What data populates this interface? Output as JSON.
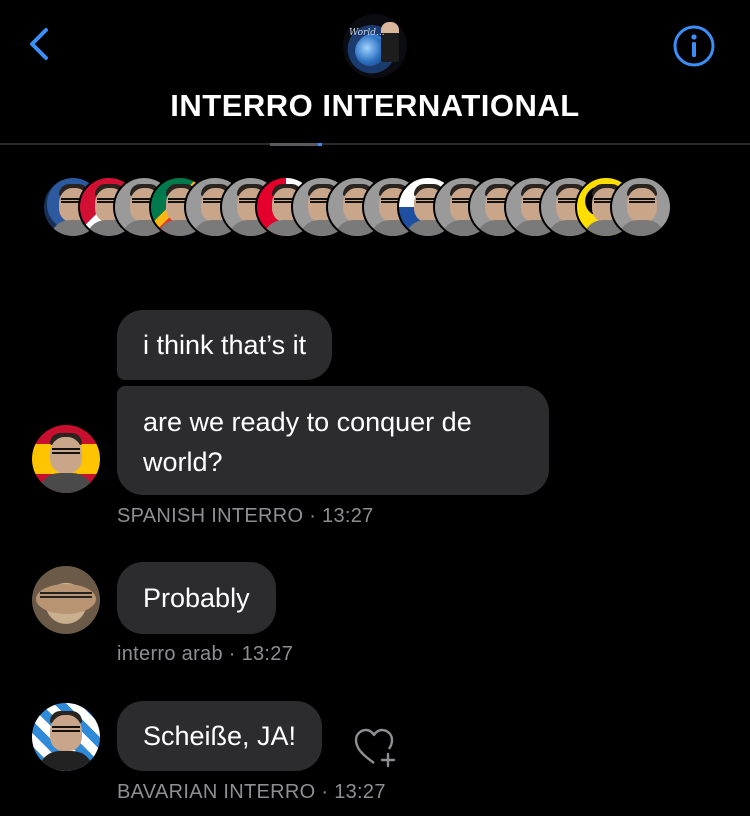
{
  "header": {
    "title": "INTERRO INTERNATIONAL",
    "group_avatar_text": "World...",
    "accent_color": "#3a8ef6"
  },
  "participants": [
    {
      "icon": "avatar"
    },
    {
      "icon": "avatar-flag-cuba"
    },
    {
      "icon": "avatar"
    },
    {
      "icon": "avatar-flag-south-africa"
    },
    {
      "icon": "avatar"
    },
    {
      "icon": "avatar"
    },
    {
      "icon": "avatar-flag-red-white"
    },
    {
      "icon": "avatar"
    },
    {
      "icon": "avatar"
    },
    {
      "icon": "avatar"
    },
    {
      "icon": "avatar-flag-blue-white"
    },
    {
      "icon": "avatar"
    },
    {
      "icon": "avatar"
    },
    {
      "icon": "avatar"
    },
    {
      "icon": "avatar"
    },
    {
      "icon": "avatar-flag-flanders"
    },
    {
      "icon": "avatar"
    }
  ],
  "messages": [
    {
      "text": "i think that’s it"
    },
    {
      "text": "are we ready to conquer de world?",
      "sender": "SPANISH INTERRO",
      "time": "· 13:27"
    },
    {
      "text": "Probably",
      "sender": "interro arab",
      "time": "· 13:27"
    },
    {
      "text": "Scheiße, JA!",
      "sender": "BAVARIAN INTERRO",
      "time": "· 13:27"
    }
  ],
  "icons": {
    "back": "chevron-left-icon",
    "info": "info-icon",
    "react": "heart-plus-icon"
  }
}
